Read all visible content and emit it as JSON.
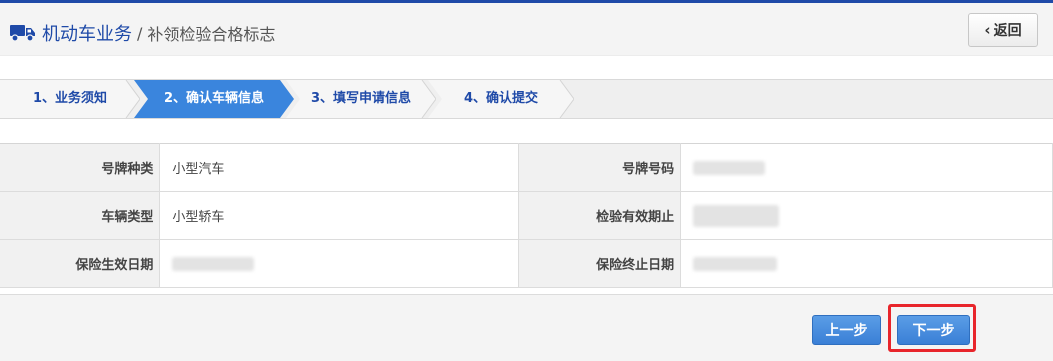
{
  "header": {
    "icon": "truck-icon",
    "breadcrumb_main": "机动车业务",
    "breadcrumb_separator": "/",
    "breadcrumb_sub": "补领检验合格标志",
    "back_label": "返回",
    "accent_color": "#1f4aa8"
  },
  "steps": [
    {
      "label": "1、业务须知",
      "active": false
    },
    {
      "label": "2、确认车辆信息",
      "active": true
    },
    {
      "label": "3、填写申请信息",
      "active": false
    },
    {
      "label": "4、确认提交",
      "active": false
    }
  ],
  "vehicle_info": {
    "rows": [
      {
        "left_label": "号牌种类",
        "left_value": "小型汽车",
        "right_label": "号牌号码",
        "right_value": ""
      },
      {
        "left_label": "车辆类型",
        "left_value": "小型轿车",
        "right_label": "检验有效期止",
        "right_value": ""
      },
      {
        "left_label": "保险生效日期",
        "left_value": "",
        "right_label": "保险终止日期",
        "right_value": ""
      }
    ]
  },
  "footer": {
    "prev_label": "上一步",
    "next_label": "下一步",
    "highlight_color": "#e8252b"
  }
}
